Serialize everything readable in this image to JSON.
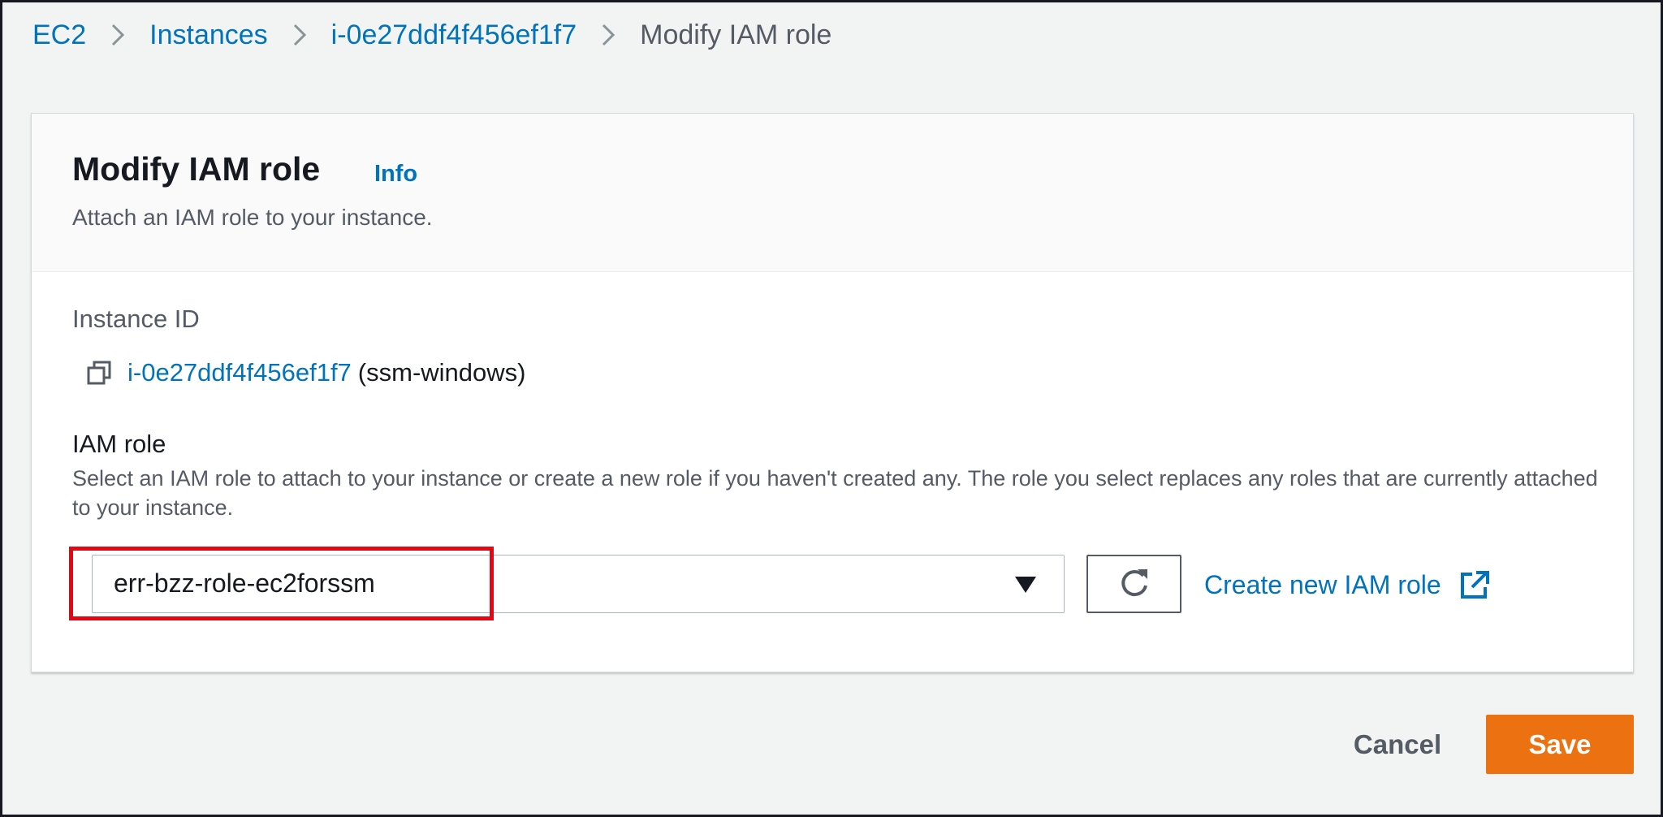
{
  "breadcrumb": {
    "items": [
      {
        "label": "EC2"
      },
      {
        "label": "Instances"
      },
      {
        "label": "i-0e27ddf4f456ef1f7"
      }
    ],
    "current": "Modify IAM role"
  },
  "panel": {
    "title": "Modify IAM role",
    "info": "Info",
    "description": "Attach an IAM role to your instance."
  },
  "instance": {
    "label": "Instance ID",
    "id": "i-0e27ddf4f456ef1f7",
    "name": "(ssm-windows)"
  },
  "iam_role": {
    "label": "IAM role",
    "description": "Select an IAM role to attach to your instance or create a new role if you haven't created any. The role you select replaces any roles that are currently attached to your instance.",
    "selected": "err-bzz-role-ec2forssm",
    "create_link": "Create new IAM role"
  },
  "actions": {
    "cancel": "Cancel",
    "save": "Save"
  },
  "colors": {
    "link": "#0073bb",
    "primary_button": "#ec7211",
    "highlight": "#e30613"
  },
  "icons": [
    "chevron-right-icon",
    "copy-icon",
    "caret-down-icon",
    "refresh-icon",
    "external-link-icon"
  ]
}
